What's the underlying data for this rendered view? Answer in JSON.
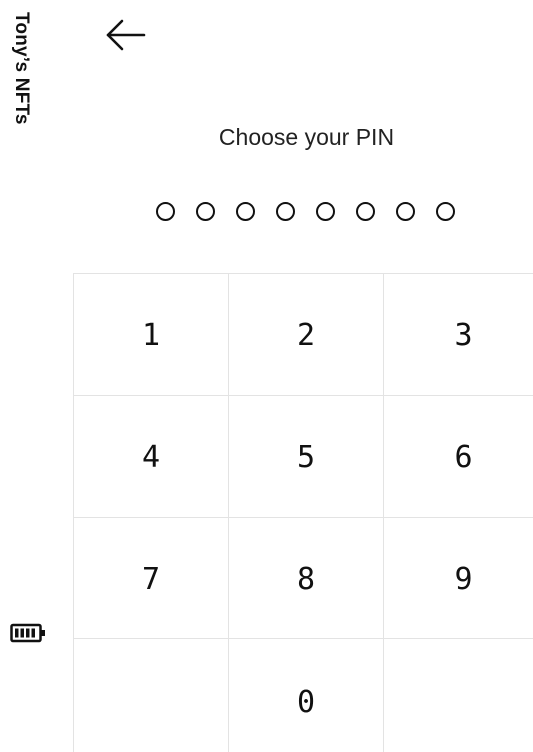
{
  "app": {
    "title": "Tony’s NFTs"
  },
  "pin": {
    "title": "Choose your PIN",
    "length": 8,
    "filled": 0
  },
  "keypad": {
    "keys": [
      "1",
      "2",
      "3",
      "4",
      "5",
      "6",
      "7",
      "8",
      "9",
      "",
      "0",
      ""
    ]
  },
  "icons": {
    "back": "arrow-left-icon",
    "battery": "battery-full-icon"
  },
  "colors": {
    "text": "#111111",
    "grid": "#e3e3e3",
    "background": "#ffffff"
  }
}
